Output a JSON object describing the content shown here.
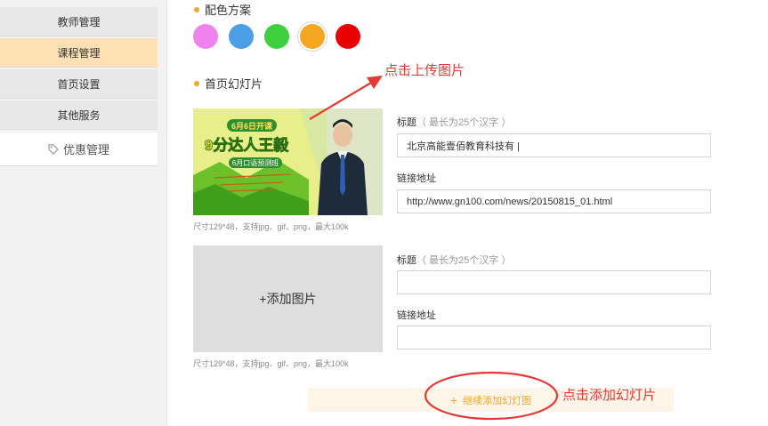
{
  "sidebar": {
    "items": [
      {
        "label": "教师管理"
      },
      {
        "label": "课程管理"
      },
      {
        "label": "首页设置"
      },
      {
        "label": "其他服务"
      },
      {
        "label": "优惠管理"
      }
    ]
  },
  "color_scheme": {
    "title": "配色方案",
    "swatches": [
      "#ee82ee",
      "#4a9ee6",
      "#3ecf3e",
      "#f5a623",
      "#e60000"
    ],
    "selected_index": 3
  },
  "slides": {
    "title": "首页幻灯片",
    "image_hint": "尺寸129*48，支持jpg、gif、png，最大100k",
    "title_label": "标题",
    "title_sub": "（ 最长为25个汉字 ）",
    "link_label": "链接地址",
    "items": [
      {
        "banner_top": "6月6日开课",
        "banner_main": "9分达人王毅",
        "banner_sub": "6月口语预测班",
        "title_value": "北京高能壹佰教育科技有 |",
        "link_value": "http://www.gn100.com/news/20150815_01.html"
      },
      {
        "empty_label": "+添加图片",
        "title_value": "",
        "link_value": ""
      }
    ],
    "add_more_label": "继续添加幻灯图"
  },
  "annotations": {
    "upload": "点击上传图片",
    "add": "点击添加幻灯片",
    "color": "#e53935"
  }
}
